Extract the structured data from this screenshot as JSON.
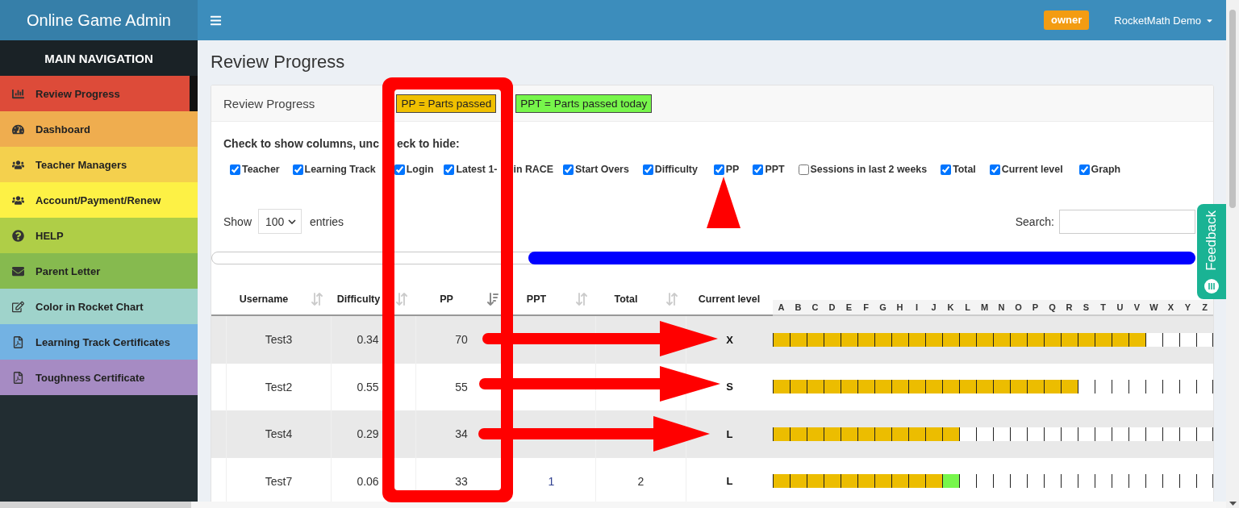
{
  "top_bar": {
    "brand": "Online Game Admin",
    "badge": "owner",
    "user": "RocketMath Demo"
  },
  "sidebar": {
    "heading": "MAIN NAVIGATION",
    "items": [
      {
        "label": "Review Progress",
        "color": "#dd4b39",
        "selected": true
      },
      {
        "label": "Dashboard",
        "color": "#efad4f",
        "selected": false
      },
      {
        "label": "Teacher Managers",
        "color": "#f4d04d",
        "selected": false
      },
      {
        "label": "Account/Payment/Renew",
        "color": "#fdf145",
        "selected": false
      },
      {
        "label": "HELP",
        "color": "#afce47",
        "selected": false
      },
      {
        "label": "Parent Letter",
        "color": "#86ba4f",
        "selected": false
      },
      {
        "label": "Color in Rocket Chart",
        "color": "#9fd3cb",
        "selected": false
      },
      {
        "label": "Learning Track Certificates",
        "color": "#73b2e3",
        "selected": false
      },
      {
        "label": "Toughness Certificate",
        "color": "#a68bc3",
        "selected": false
      }
    ]
  },
  "page_title": "Review Progress",
  "panel": {
    "title": "Review Progress",
    "legend": [
      {
        "label": "PP = Parts passed",
        "color": "#f0c000"
      },
      {
        "label": "PPT = Parts passed today",
        "color": "#77f64b"
      }
    ],
    "instructions": [
      "Check to show columns, unc",
      "eck to hide:"
    ],
    "column_toggles": [
      {
        "label": "Teacher",
        "checked": true
      },
      {
        "label": "Learning Track",
        "checked": true
      },
      {
        "label": "Login",
        "checked": true
      },
      {
        "label": "Latest 1-",
        "label_continued": "in RACE",
        "checked": true
      },
      {
        "label": "Start Overs",
        "checked": true
      },
      {
        "label": "Difficulty",
        "checked": true
      },
      {
        "label": "PP",
        "checked": true
      },
      {
        "label": "PPT",
        "checked": true
      },
      {
        "label": "Sessions in last 2 weeks",
        "checked": false
      },
      {
        "label": "Total",
        "checked": true
      },
      {
        "label": "Current level",
        "checked": true
      },
      {
        "label": "Graph",
        "checked": true
      }
    ],
    "length_menu": {
      "prefix": "Show",
      "value": "100",
      "suffix": "entries"
    },
    "search": {
      "label": "Search:"
    },
    "table": {
      "columns": [
        {
          "label": "Username",
          "sortable": true,
          "sorted": false
        },
        {
          "label": "Difficulty",
          "sortable": true,
          "sorted": false
        },
        {
          "label": "PP",
          "sortable": true,
          "sorted": true
        },
        {
          "label": "PPT",
          "sortable": true,
          "sorted": false
        },
        {
          "label": "Total",
          "sortable": true,
          "sorted": false
        },
        {
          "label": "Current level",
          "sortable": false,
          "sorted": false
        }
      ],
      "graph_columns": [
        "A",
        "B",
        "C",
        "D",
        "E",
        "F",
        "G",
        "H",
        "I",
        "J",
        "K",
        "L",
        "M",
        "N",
        "O",
        "P",
        "Q",
        "R",
        "S",
        "T",
        "U",
        "V",
        "W",
        "X",
        "Y",
        "Z"
      ],
      "rows": [
        {
          "username": "Test3",
          "difficulty": "0.34",
          "pp": "70",
          "current_level": "X",
          "arrow": true,
          "graph": [
            {
              "color": "#ecbd00"
            },
            {
              "color": "#ecbd00"
            },
            {
              "color": "#ecbd00"
            },
            {
              "color": "#ecbd00"
            },
            {
              "color": "#ecbd00"
            },
            {
              "color": "#ecbd00"
            },
            {
              "color": "#ecbd00"
            },
            {
              "color": "#ecbd00"
            },
            {
              "color": "#ecbd00"
            },
            {
              "color": "#ecbd00"
            },
            {
              "color": "#ecbd00"
            },
            {
              "color": "#ecbd00"
            },
            {
              "color": "#ecbd00"
            },
            {
              "color": "#ecbd00"
            },
            {
              "color": "#ecbd00"
            },
            {
              "color": "#ecbd00"
            },
            {
              "color": "#ecbd00"
            },
            {
              "color": "#ecbd00"
            },
            {
              "color": "#ecbd00"
            },
            {
              "color": "#ecbd00"
            },
            {
              "color": "#ecbd00"
            },
            {
              "color": "#ecbd00"
            },
            {
              "color": "#ffffff"
            },
            {
              "color": "#ffffff"
            },
            {
              "color": "#ffffff"
            },
            {
              "color": "#ffffff"
            }
          ]
        },
        {
          "username": "Test2",
          "difficulty": "0.55",
          "pp": "55",
          "current_level": "S",
          "arrow": true,
          "graph": [
            {
              "color": "#ecbd00"
            },
            {
              "color": "#ecbd00"
            },
            {
              "color": "#ecbd00"
            },
            {
              "color": "#ecbd00"
            },
            {
              "color": "#ecbd00"
            },
            {
              "color": "#ecbd00"
            },
            {
              "color": "#ecbd00"
            },
            {
              "color": "#ecbd00"
            },
            {
              "color": "#ecbd00"
            },
            {
              "color": "#ecbd00"
            },
            {
              "color": "#ecbd00"
            },
            {
              "color": "#ecbd00"
            },
            {
              "color": "#ecbd00"
            },
            {
              "color": "#ecbd00"
            },
            {
              "color": "#ecbd00"
            },
            {
              "color": "#ecbd00"
            },
            {
              "color": "#ecbd00"
            },
            {
              "color": "#ecbd00"
            },
            {
              "color": "#ffffff"
            },
            {
              "color": "#ffffff"
            },
            {
              "color": "#ffffff"
            },
            {
              "color": "#ffffff"
            },
            {
              "color": "#ffffff"
            },
            {
              "color": "#ffffff"
            },
            {
              "color": "#ffffff"
            },
            {
              "color": "#ffffff"
            }
          ]
        },
        {
          "username": "Test4",
          "difficulty": "0.29",
          "pp": "34",
          "current_level": "L",
          "arrow": true,
          "graph": [
            {
              "color": "#ecbd00"
            },
            {
              "color": "#ecbd00"
            },
            {
              "color": "#ecbd00"
            },
            {
              "color": "#ecbd00"
            },
            {
              "color": "#ecbd00"
            },
            {
              "color": "#ecbd00"
            },
            {
              "color": "#ecbd00"
            },
            {
              "color": "#ecbd00"
            },
            {
              "color": "#ecbd00"
            },
            {
              "color": "#ecbd00"
            },
            {
              "color": "#ecbd00"
            },
            {
              "color": "#ffffff"
            },
            {
              "color": "#ffffff"
            },
            {
              "color": "#ffffff"
            },
            {
              "color": "#ffffff"
            },
            {
              "color": "#ffffff"
            },
            {
              "color": "#ffffff"
            },
            {
              "color": "#ffffff"
            },
            {
              "color": "#ffffff"
            },
            {
              "color": "#ffffff"
            },
            {
              "color": "#ffffff"
            },
            {
              "color": "#ffffff"
            },
            {
              "color": "#ffffff"
            },
            {
              "color": "#ffffff"
            },
            {
              "color": "#ffffff"
            },
            {
              "color": "#ffffff"
            }
          ]
        },
        {
          "username": "Test7",
          "difficulty": "0.06",
          "pp": "33",
          "ppt": "1",
          "total": "2",
          "current_level": "L",
          "arrow": false,
          "graph": [
            {
              "color": "#ecbd00"
            },
            {
              "color": "#ecbd00"
            },
            {
              "color": "#ecbd00"
            },
            {
              "color": "#ecbd00"
            },
            {
              "color": "#ecbd00"
            },
            {
              "color": "#ecbd00"
            },
            {
              "color": "#ecbd00"
            },
            {
              "color": "#ecbd00"
            },
            {
              "color": "#ecbd00"
            },
            {
              "color": "#ecbd00"
            },
            {
              "color": "#77f64b"
            },
            {
              "color": "#ffffff"
            },
            {
              "color": "#ffffff"
            },
            {
              "color": "#ffffff"
            },
            {
              "color": "#ffffff"
            },
            {
              "color": "#ffffff"
            },
            {
              "color": "#ffffff"
            },
            {
              "color": "#ffffff"
            },
            {
              "color": "#ffffff"
            },
            {
              "color": "#ffffff"
            },
            {
              "color": "#ffffff"
            },
            {
              "color": "#ffffff"
            },
            {
              "color": "#ffffff"
            },
            {
              "color": "#ffffff"
            },
            {
              "color": "#ffffff"
            },
            {
              "color": "#ffffff"
            }
          ]
        }
      ]
    }
  },
  "feedback_tab": {
    "label": "Feedback"
  },
  "annotations": {
    "frame": true,
    "pointer": true
  }
}
